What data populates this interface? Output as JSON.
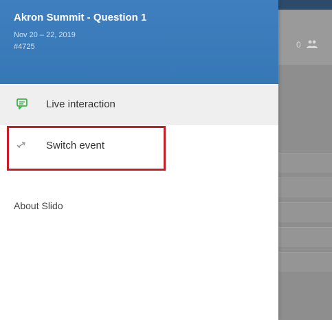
{
  "background_app": {
    "count": "0",
    "people_icon": "people-icon"
  },
  "event": {
    "title": "Akron Summit - Question 1",
    "dates": "Nov 20 – 22, 2019",
    "code": "#4725"
  },
  "menu": {
    "items": [
      {
        "label": "Live interaction",
        "icon": "chat-icon",
        "active": true
      },
      {
        "label": "Switch event",
        "icon": "swap-arrows-icon",
        "active": false
      }
    ]
  },
  "about_label": "About Slido",
  "colors": {
    "header_blue": "#3677b6",
    "chat_icon_green": "#39b54a",
    "highlight_red": "#c21f2a"
  }
}
